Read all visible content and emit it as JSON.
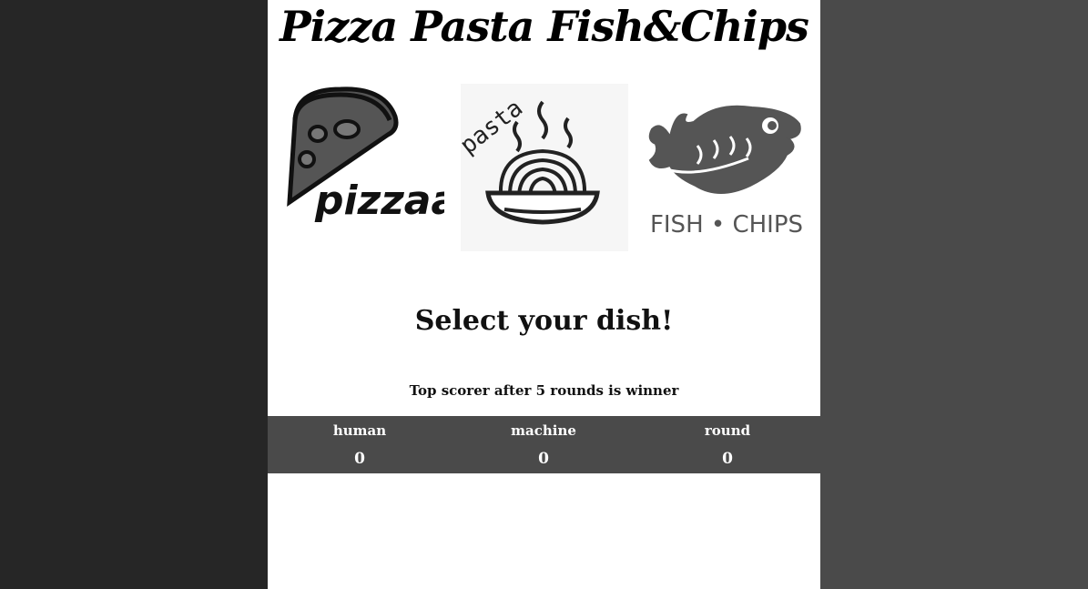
{
  "game": {
    "title": "Pizza Pasta Fish&Chips",
    "choices": [
      {
        "id": "pizza",
        "logo_text": "pizzaa"
      },
      {
        "id": "pasta",
        "logo_text": "pasta"
      },
      {
        "id": "fish",
        "logo_text": "FISH • CHIPS"
      }
    ],
    "prompt": "Select your dish!",
    "rule": "Top scorer after 5 rounds is winner"
  },
  "scoreboard": {
    "human_label": "human",
    "human_value": "0",
    "machine_label": "machine",
    "machine_value": "0",
    "round_label": "round",
    "round_value": "0"
  },
  "colors": {
    "left_panel": "#262626",
    "right_panel": "#4a4a4a",
    "scorebar": "#4a4a4a",
    "content": "#ffffff"
  }
}
